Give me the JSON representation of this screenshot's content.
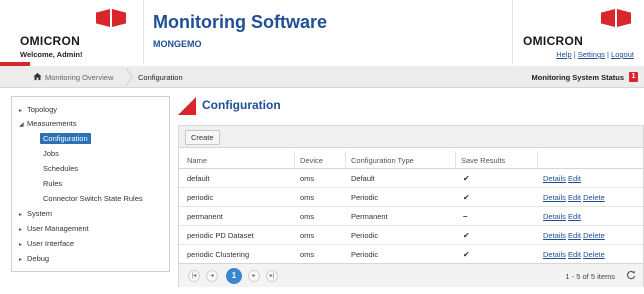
{
  "header": {
    "brand_left": "OMICRON",
    "welcome": "Welcome, Admin!",
    "app_title": "Monitoring Software",
    "app_subtitle": "MONGEMO",
    "brand_right": "OMICRON",
    "links": {
      "help": "Help",
      "settings": "Settings",
      "logout": "Logout",
      "separator": "|"
    },
    "accent_color": "#d9262d",
    "title_color": "#1f4f95"
  },
  "breadcrumb": {
    "items": [
      "Monitoring Overview",
      "Configuration"
    ],
    "status_label": "Monitoring System Status",
    "status_count": "1"
  },
  "sidebar": {
    "items": [
      {
        "label": "Topology",
        "arrow": "▸"
      },
      {
        "label": "Measurements",
        "arrow": "◢"
      },
      {
        "label": "Configuration",
        "selected": true
      },
      {
        "label": "Jobs"
      },
      {
        "label": "Schedules"
      },
      {
        "label": "Rules"
      },
      {
        "label": "Connector Switch State Rules"
      },
      {
        "label": "System",
        "arrow": "▸"
      },
      {
        "label": "User Management",
        "arrow": "▸"
      },
      {
        "label": "User Interface",
        "arrow": "▸"
      },
      {
        "label": "Debug",
        "arrow": "▸"
      }
    ]
  },
  "main": {
    "title": "Configuration",
    "create_label": "Create",
    "columns": [
      "Name",
      "Device",
      "Configuration Type",
      "Save Results"
    ],
    "rows": [
      {
        "name": "default",
        "device": "oms",
        "type": "Default",
        "save": "✔"
      },
      {
        "name": "periodic",
        "device": "oms",
        "type": "Periodic",
        "save": "✔"
      },
      {
        "name": "permanent",
        "device": "oms",
        "type": "Permanent",
        "save": "–"
      },
      {
        "name": "periodic PD Dataset",
        "device": "oms",
        "type": "Periodic",
        "save": "✔"
      },
      {
        "name": "periodic Clustering",
        "device": "oms",
        "type": "Periodic",
        "save": "✔"
      }
    ],
    "actions": {
      "details": "Details",
      "edit": "Edit",
      "delete": "Delete"
    },
    "pager": {
      "first": "|◂",
      "prev": "◂",
      "current_page": "1",
      "next": "▸",
      "last": "▸|",
      "info": "1 - 5 of 5 items"
    }
  }
}
